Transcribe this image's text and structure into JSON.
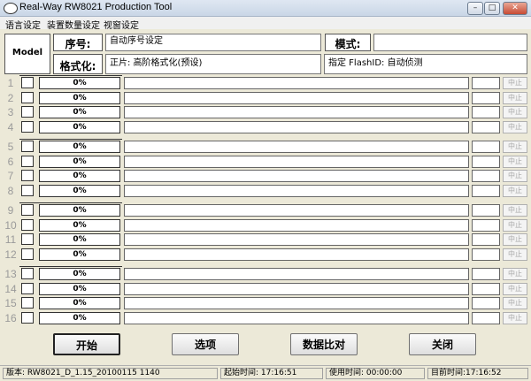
{
  "window": {
    "title": "Real-Way RW8021 Production Tool",
    "min": "–",
    "max": "□",
    "close": "✕"
  },
  "menu": [
    "语言设定",
    "装置数量设定",
    "视窗设定"
  ],
  "header": {
    "model_label": "Model",
    "serial_label": "序号:",
    "serial_value": "自动序号设定",
    "mode_label": "模式:",
    "mode_value": "",
    "format_label": "格式化:",
    "format_value": "正片: 高阶格式化(预设)",
    "flash_value": "指定 FlashID: 自动侦测"
  },
  "rows": [
    {
      "n": "1",
      "pct": "0%",
      "stop": "中止"
    },
    {
      "n": "2",
      "pct": "0%",
      "stop": "中止"
    },
    {
      "n": "3",
      "pct": "0%",
      "stop": "中止"
    },
    {
      "n": "4",
      "pct": "0%",
      "stop": "中止"
    },
    {
      "n": "5",
      "pct": "0%",
      "stop": "中止"
    },
    {
      "n": "6",
      "pct": "0%",
      "stop": "中止"
    },
    {
      "n": "7",
      "pct": "0%",
      "stop": "中止"
    },
    {
      "n": "8",
      "pct": "0%",
      "stop": "中止"
    },
    {
      "n": "9",
      "pct": "0%",
      "stop": "中止"
    },
    {
      "n": "10",
      "pct": "0%",
      "stop": "中止"
    },
    {
      "n": "11",
      "pct": "0%",
      "stop": "中止"
    },
    {
      "n": "12",
      "pct": "0%",
      "stop": "中止"
    },
    {
      "n": "13",
      "pct": "0%",
      "stop": "中止"
    },
    {
      "n": "14",
      "pct": "0%",
      "stop": "中止"
    },
    {
      "n": "15",
      "pct": "0%",
      "stop": "中止"
    },
    {
      "n": "16",
      "pct": "0%",
      "stop": "中止"
    }
  ],
  "buttons": {
    "start": "开始",
    "options": "选项",
    "compare": "数据比对",
    "close": "关闭"
  },
  "status": {
    "version": "版本: RW8021_D_1.15_20100115 1140",
    "start_time": "起始时间: 17:16:51",
    "used_time": "使用时间: 00:00:00",
    "current_time": "目前时间:17:16:52"
  }
}
